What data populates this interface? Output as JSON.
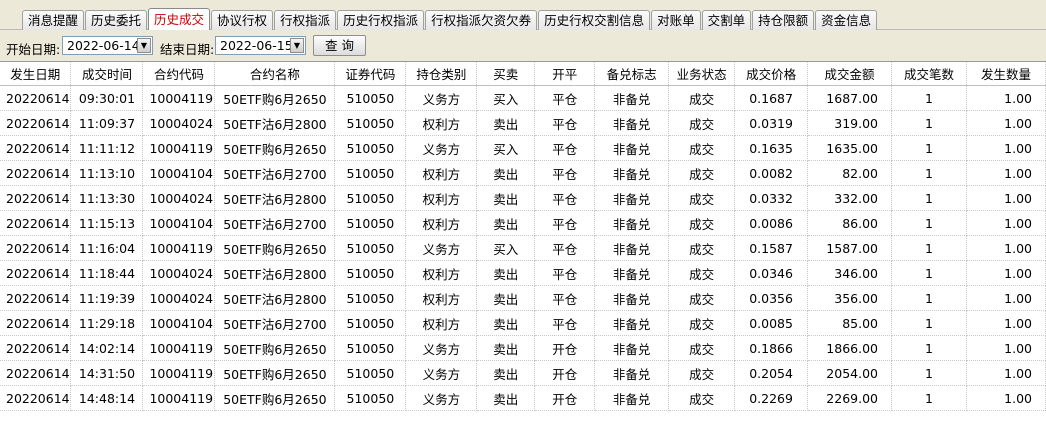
{
  "tabs": [
    {
      "label": "消息提醒",
      "active": false
    },
    {
      "label": "历史委托",
      "active": false
    },
    {
      "label": "历史成交",
      "active": true
    },
    {
      "label": "协议行权",
      "active": false
    },
    {
      "label": "行权指派",
      "active": false
    },
    {
      "label": "历史行权指派",
      "active": false
    },
    {
      "label": "行权指派欠资欠券",
      "active": false
    },
    {
      "label": "历史行权交割信息",
      "active": false
    },
    {
      "label": "对账单",
      "active": false
    },
    {
      "label": "交割单",
      "active": false
    },
    {
      "label": "持仓限额",
      "active": false
    },
    {
      "label": "资金信息",
      "active": false
    }
  ],
  "query": {
    "start_label": "开始日期:",
    "start_date": "2022-06-14",
    "end_label": "结束日期:",
    "end_date": "2022-06-15",
    "dropdown_glyph": "▼",
    "query_button": "查 询"
  },
  "table": {
    "columns": [
      "发生日期",
      "成交时间",
      "合约代码",
      "合约名称",
      "证券代码",
      "持仓类别",
      "买卖",
      "开平",
      "备兑标志",
      "业务状态",
      "成交价格",
      "成交金额",
      "成交笔数",
      "发生数量"
    ],
    "rows": [
      [
        "20220614",
        "09:30:01",
        "10004119",
        "50ETF购6月2650",
        "510050",
        "义务方",
        "买入",
        "平仓",
        "非备兑",
        "成交",
        "0.1687",
        "1687.00",
        "1",
        "1.00"
      ],
      [
        "20220614",
        "11:09:37",
        "10004024",
        "50ETF沽6月2800",
        "510050",
        "权利方",
        "卖出",
        "平仓",
        "非备兑",
        "成交",
        "0.0319",
        "319.00",
        "1",
        "1.00"
      ],
      [
        "20220614",
        "11:11:12",
        "10004119",
        "50ETF购6月2650",
        "510050",
        "义务方",
        "买入",
        "平仓",
        "非备兑",
        "成交",
        "0.1635",
        "1635.00",
        "1",
        "1.00"
      ],
      [
        "20220614",
        "11:13:10",
        "10004104",
        "50ETF沽6月2700",
        "510050",
        "权利方",
        "卖出",
        "平仓",
        "非备兑",
        "成交",
        "0.0082",
        "82.00",
        "1",
        "1.00"
      ],
      [
        "20220614",
        "11:13:30",
        "10004024",
        "50ETF沽6月2800",
        "510050",
        "权利方",
        "卖出",
        "平仓",
        "非备兑",
        "成交",
        "0.0332",
        "332.00",
        "1",
        "1.00"
      ],
      [
        "20220614",
        "11:15:13",
        "10004104",
        "50ETF沽6月2700",
        "510050",
        "权利方",
        "卖出",
        "平仓",
        "非备兑",
        "成交",
        "0.0086",
        "86.00",
        "1",
        "1.00"
      ],
      [
        "20220614",
        "11:16:04",
        "10004119",
        "50ETF购6月2650",
        "510050",
        "义务方",
        "买入",
        "平仓",
        "非备兑",
        "成交",
        "0.1587",
        "1587.00",
        "1",
        "1.00"
      ],
      [
        "20220614",
        "11:18:44",
        "10004024",
        "50ETF沽6月2800",
        "510050",
        "权利方",
        "卖出",
        "平仓",
        "非备兑",
        "成交",
        "0.0346",
        "346.00",
        "1",
        "1.00"
      ],
      [
        "20220614",
        "11:19:39",
        "10004024",
        "50ETF沽6月2800",
        "510050",
        "权利方",
        "卖出",
        "平仓",
        "非备兑",
        "成交",
        "0.0356",
        "356.00",
        "1",
        "1.00"
      ],
      [
        "20220614",
        "11:29:18",
        "10004104",
        "50ETF沽6月2700",
        "510050",
        "权利方",
        "卖出",
        "平仓",
        "非备兑",
        "成交",
        "0.0085",
        "85.00",
        "1",
        "1.00"
      ],
      [
        "20220614",
        "14:02:14",
        "10004119",
        "50ETF购6月2650",
        "510050",
        "义务方",
        "卖出",
        "开仓",
        "非备兑",
        "成交",
        "0.1866",
        "1866.00",
        "1",
        "1.00"
      ],
      [
        "20220614",
        "14:31:50",
        "10004119",
        "50ETF购6月2650",
        "510050",
        "义务方",
        "卖出",
        "开仓",
        "非备兑",
        "成交",
        "0.2054",
        "2054.00",
        "1",
        "1.00"
      ],
      [
        "20220614",
        "14:48:14",
        "10004119",
        "50ETF购6月2650",
        "510050",
        "义务方",
        "卖出",
        "开仓",
        "非备兑",
        "成交",
        "0.2269",
        "2269.00",
        "1",
        "1.00"
      ]
    ]
  },
  "colors": {
    "active_tab_text": "#cc0000",
    "toolbar_bg": "#ece9d8"
  }
}
